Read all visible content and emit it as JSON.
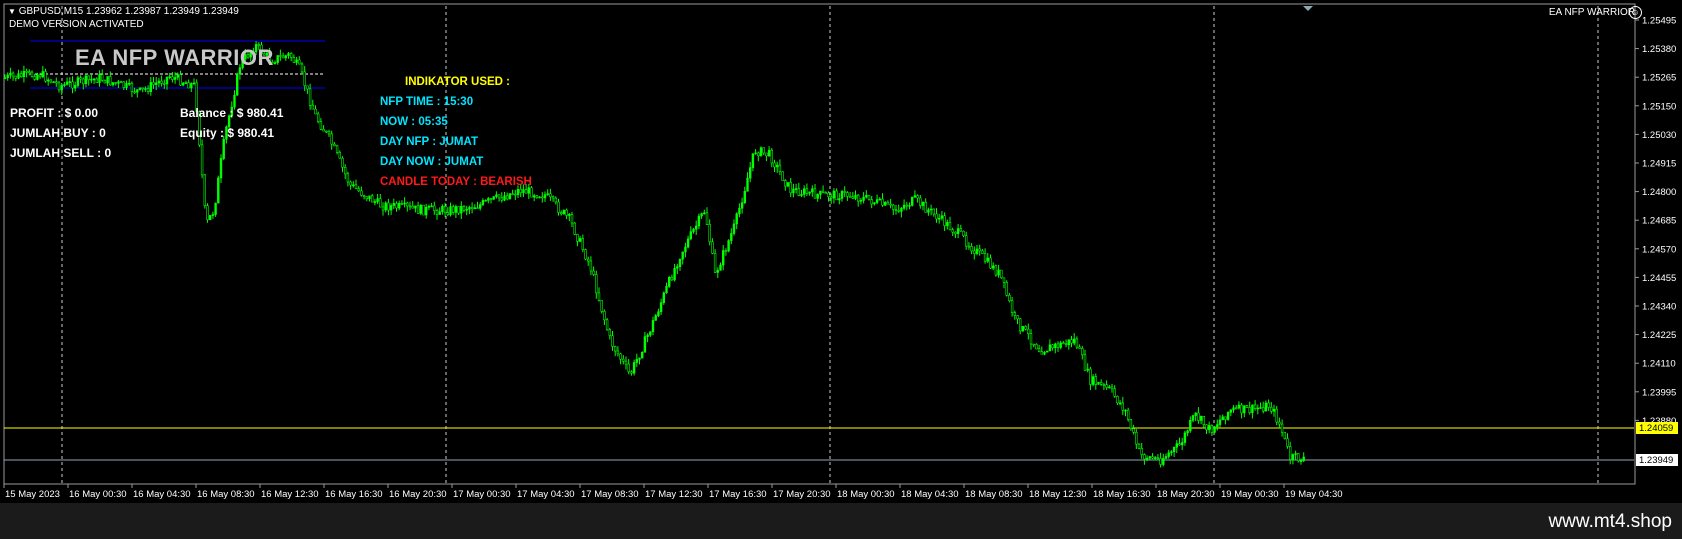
{
  "header": {
    "symbol_line": "GBPUSD,M15  1.23962 1.23987 1.23949 1.23949",
    "demo_label": "DEMO VERSION ACTIVATED",
    "ea_name_corner": "EA NFP WARRIOR"
  },
  "ea_panel": {
    "title": "EA NFP WARRIOR",
    "profit": "PROFIT : $ 0.00",
    "jumlah_buy": "JUMLAH BUY   : 0",
    "jumlah_sell": "JUMLAH SELL : 0",
    "balance": "Balance   : $ 980.41",
    "equity": "Equity     : $ 980.41"
  },
  "indicator_panel": {
    "heading": "INDIKATOR USED :",
    "nfp_time": "NFP TIME : 15:30",
    "now": "NOW        : 05:35",
    "day_nfp": "DAY NFP    : JUMAT",
    "day_now": "DAY NOW : JUMAT",
    "candle_today": "CANDLE TODAY    : BEARISH",
    "colors": {
      "heading": "#ffff00",
      "info": "#00e5ff",
      "alert": "#ff1a1a"
    }
  },
  "price_axis": {
    "ticks": [
      "1.25495",
      "1.25380",
      "1.25265",
      "1.25150",
      "1.25030",
      "1.24915",
      "1.24800",
      "1.24685",
      "1.24570",
      "1.24455",
      "1.24340",
      "1.24225",
      "1.24110",
      "1.23995",
      "1.23880"
    ],
    "current_price_label": "1.23949",
    "hline_price_label": "1.24059"
  },
  "time_axis": {
    "ticks": [
      "15 May 2023",
      "16 May 00:30",
      "16 May 04:30",
      "16 May 08:30",
      "16 May 12:30",
      "16 May 16:30",
      "16 May 20:30",
      "17 May 00:30",
      "17 May 04:30",
      "17 May 08:30",
      "17 May 12:30",
      "17 May 16:30",
      "17 May 20:30",
      "18 May 00:30",
      "18 May 04:30",
      "18 May 08:30",
      "18 May 12:30",
      "18 May 16:30",
      "18 May 20:30",
      "19 May 00:30",
      "19 May 04:30"
    ]
  },
  "colors": {
    "candle": "#00ff00",
    "background": "#000000",
    "hline": "#ffff00",
    "bid_line": "#8fa8b8",
    "grid": "#cccccc",
    "panel_line": "#0000ff"
  },
  "watermark": "www.mt4.shop"
}
